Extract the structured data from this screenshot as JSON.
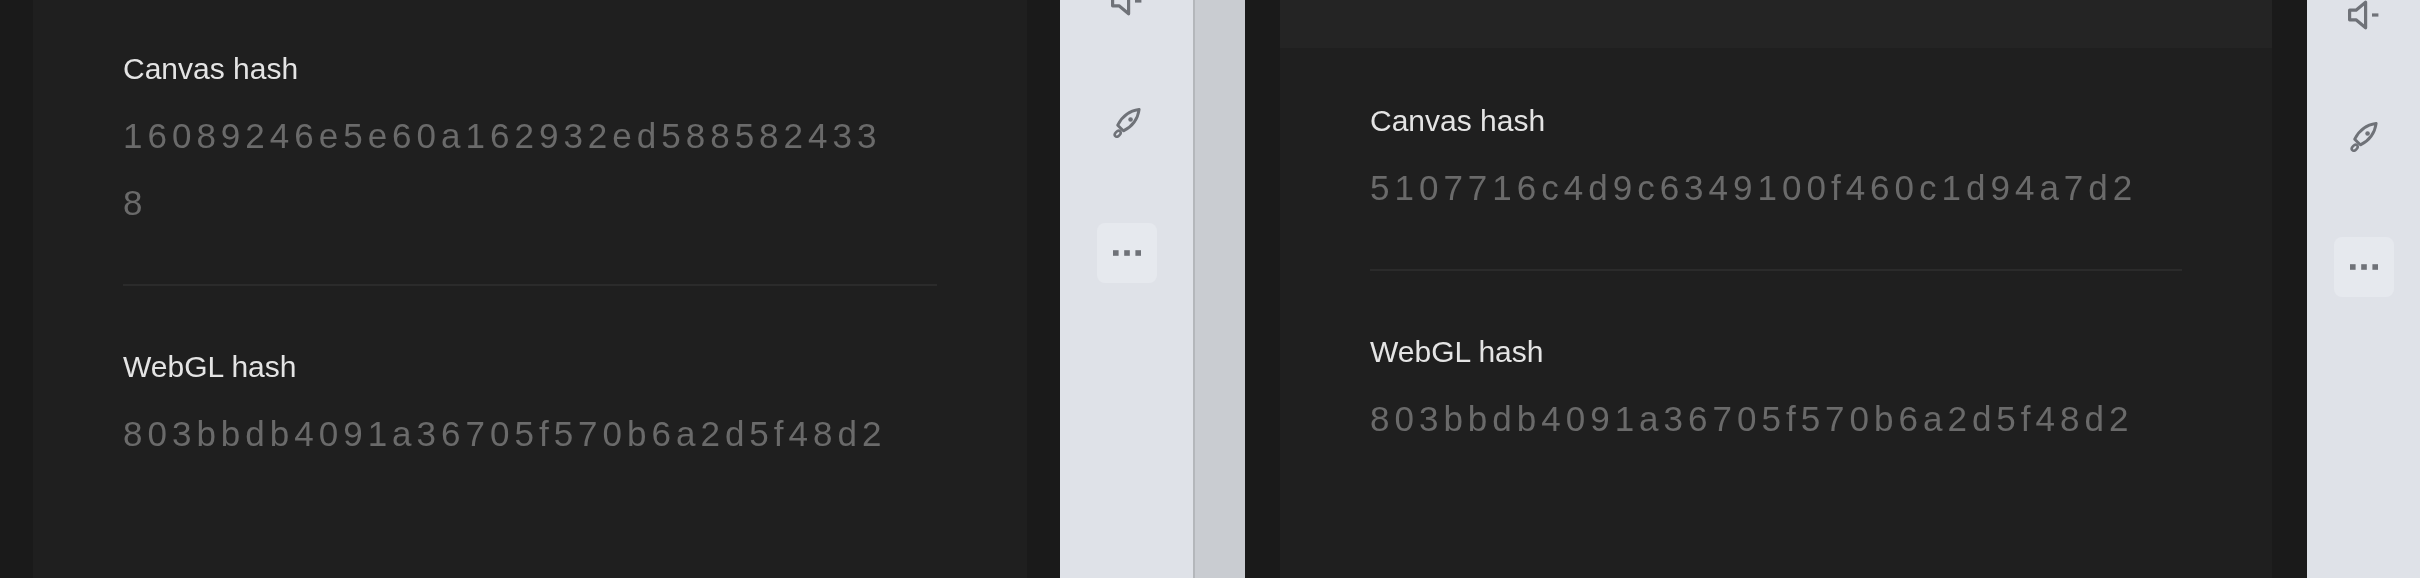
{
  "panels": [
    {
      "header": false,
      "fields": [
        {
          "label": "Canvas hash",
          "value": "16089246e5e60a162932ed5885824338"
        },
        {
          "label": "WebGL hash",
          "value": "803bbdb4091a36705f570b6a2d5f48d2"
        }
      ],
      "toolbar": [
        {
          "kind": "speaker"
        },
        {
          "kind": "rocket"
        },
        {
          "kind": "more"
        }
      ]
    },
    {
      "header": true,
      "fields": [
        {
          "label": "Canvas hash",
          "value": "5107716c4d9c6349100f460c1d94a7d2"
        },
        {
          "label": "WebGL hash",
          "value": "803bbdb4091a36705f570b6a2d5f48d2"
        }
      ],
      "toolbar": [
        {
          "kind": "speaker"
        },
        {
          "kind": "rocket"
        },
        {
          "kind": "more"
        }
      ]
    }
  ]
}
